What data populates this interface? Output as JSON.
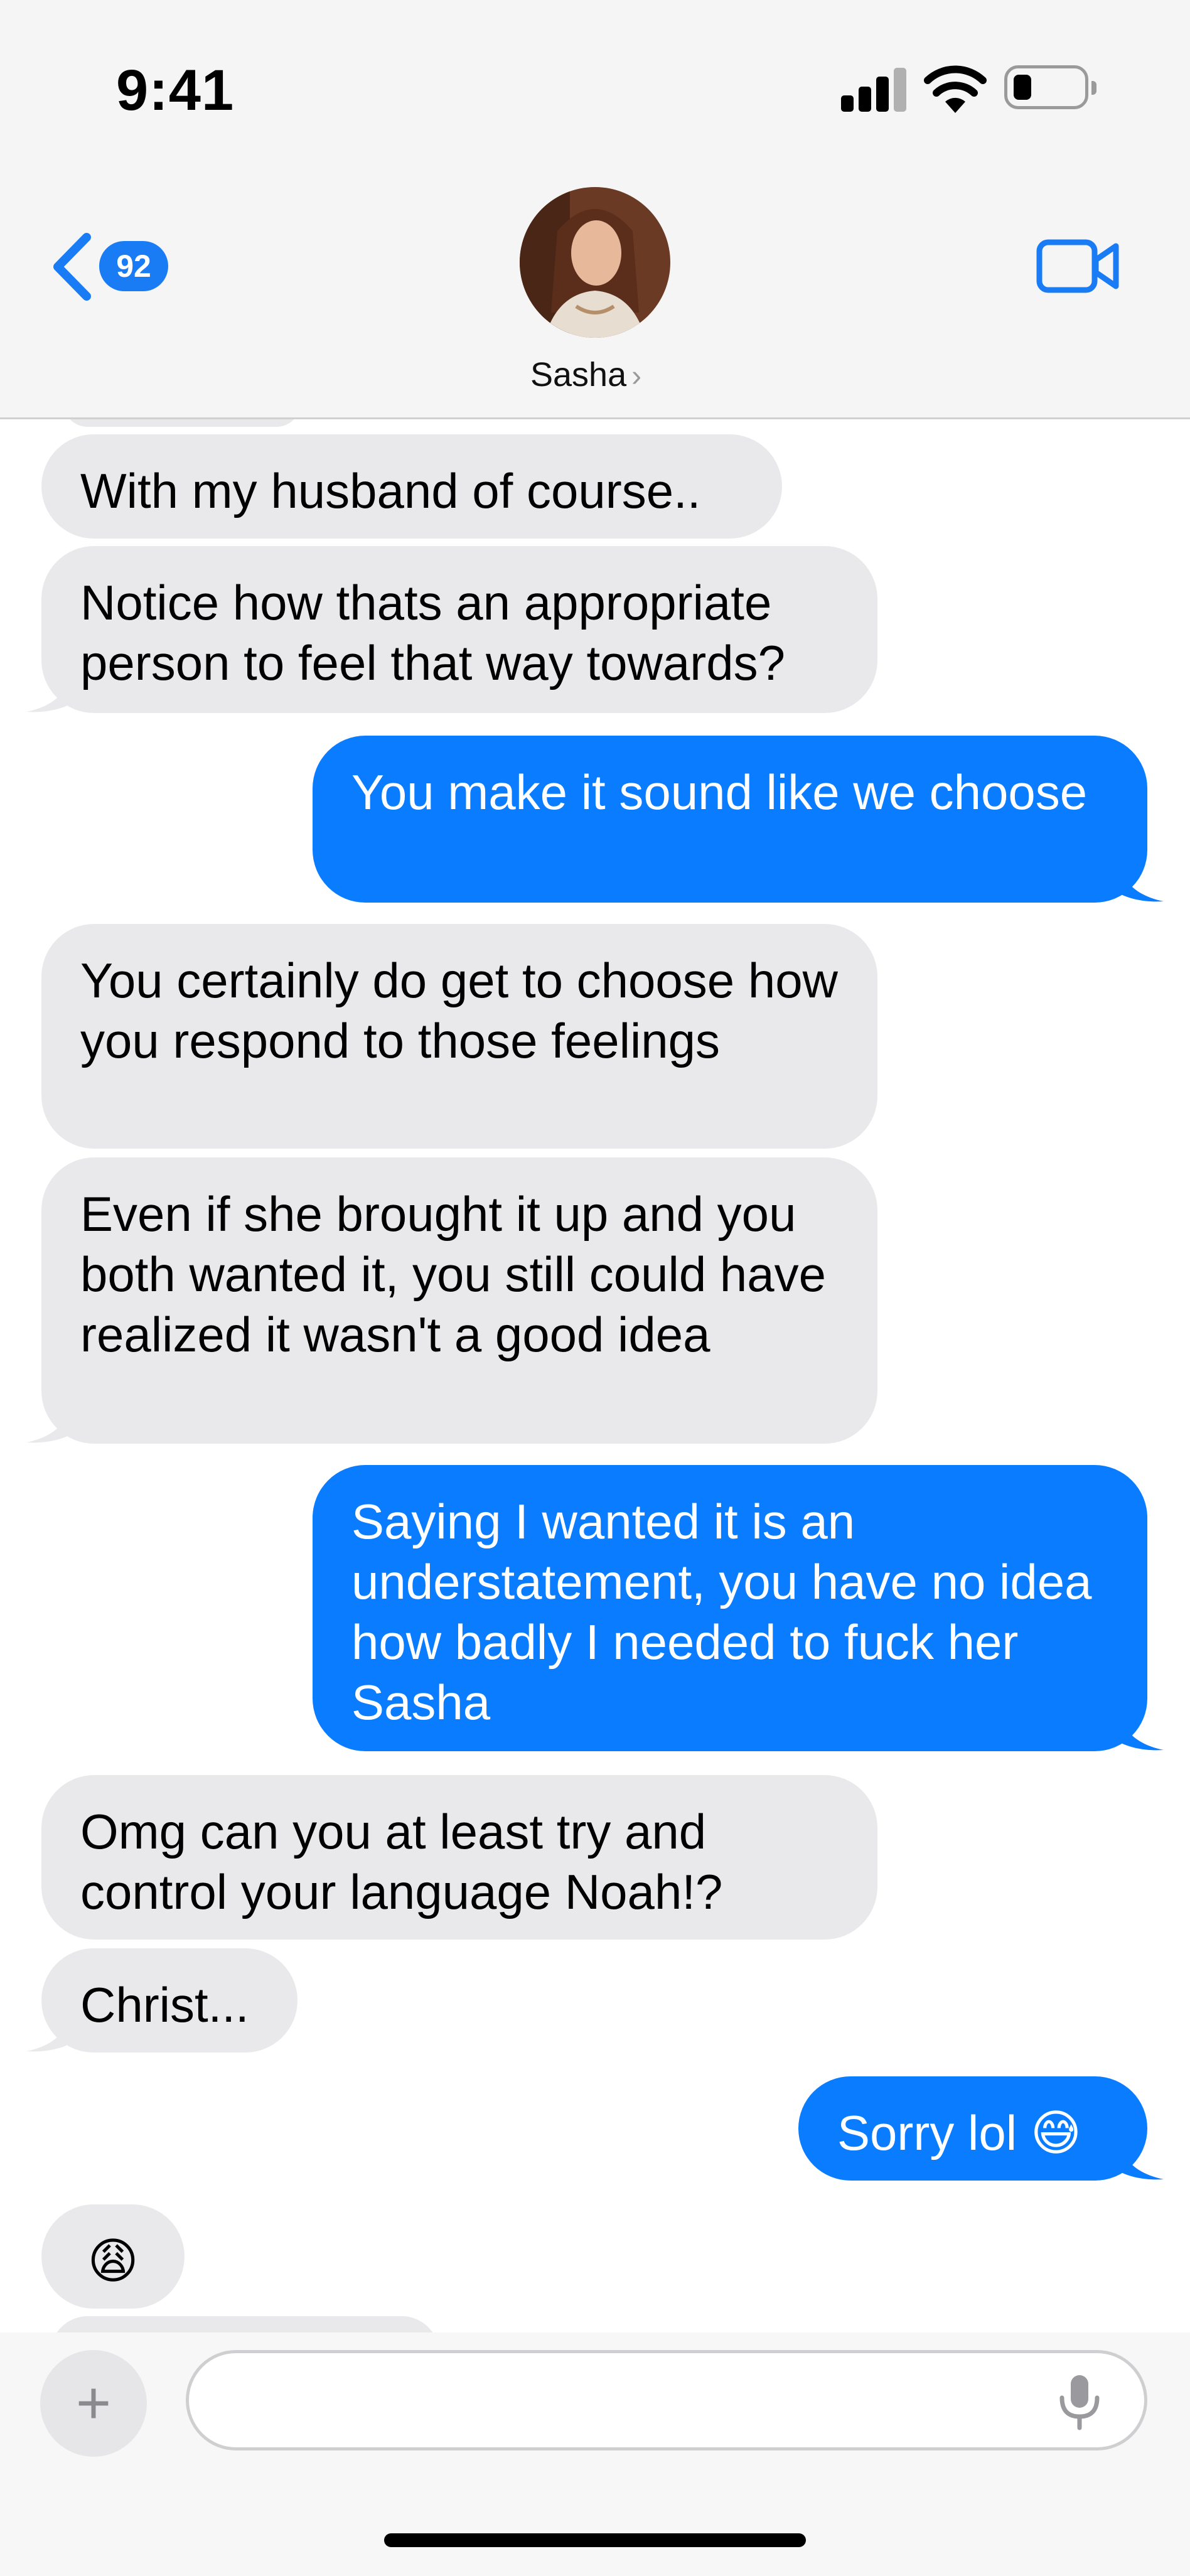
{
  "status_bar": {
    "time": "9:41"
  },
  "header": {
    "back_badge": "92",
    "contact_name": "Sasha",
    "contact_chevron": "›"
  },
  "messages": [
    {
      "direction": "incoming",
      "text": "With my husband of course.."
    },
    {
      "direction": "incoming",
      "text": "Notice how thats an appropriate person to feel that way towards?"
    },
    {
      "direction": "outgoing",
      "text": "You make it sound like we choose"
    },
    {
      "direction": "incoming",
      "text": "You certainly do get to choose how you respond to those feelings"
    },
    {
      "direction": "incoming",
      "text": "Even if she brought it up and you both wanted it, you still could have realized it wasn't a good idea"
    },
    {
      "direction": "outgoing",
      "text": "Saying I wanted it is an understatement, you have no idea how badly I needed to fuck her Sasha"
    },
    {
      "direction": "incoming",
      "text": "Omg can you at least try and control your language Noah!?"
    },
    {
      "direction": "incoming",
      "text": "Christ..."
    },
    {
      "direction": "outgoing",
      "text": "Sorry lol 😅"
    },
    {
      "direction": "incoming",
      "text": "😩"
    }
  ],
  "composer": {
    "plus_label": "+"
  },
  "icons": {
    "back": "chevron-left-icon",
    "video": "video-camera-icon",
    "mic": "microphone-icon",
    "signal": "cellular-signal-icon",
    "wifi": "wifi-icon",
    "battery": "battery-icon"
  },
  "colors": {
    "outgoing_bubble": "#0a7cff",
    "incoming_bubble": "#e9e9eb",
    "accent": "#1a7cf5"
  }
}
